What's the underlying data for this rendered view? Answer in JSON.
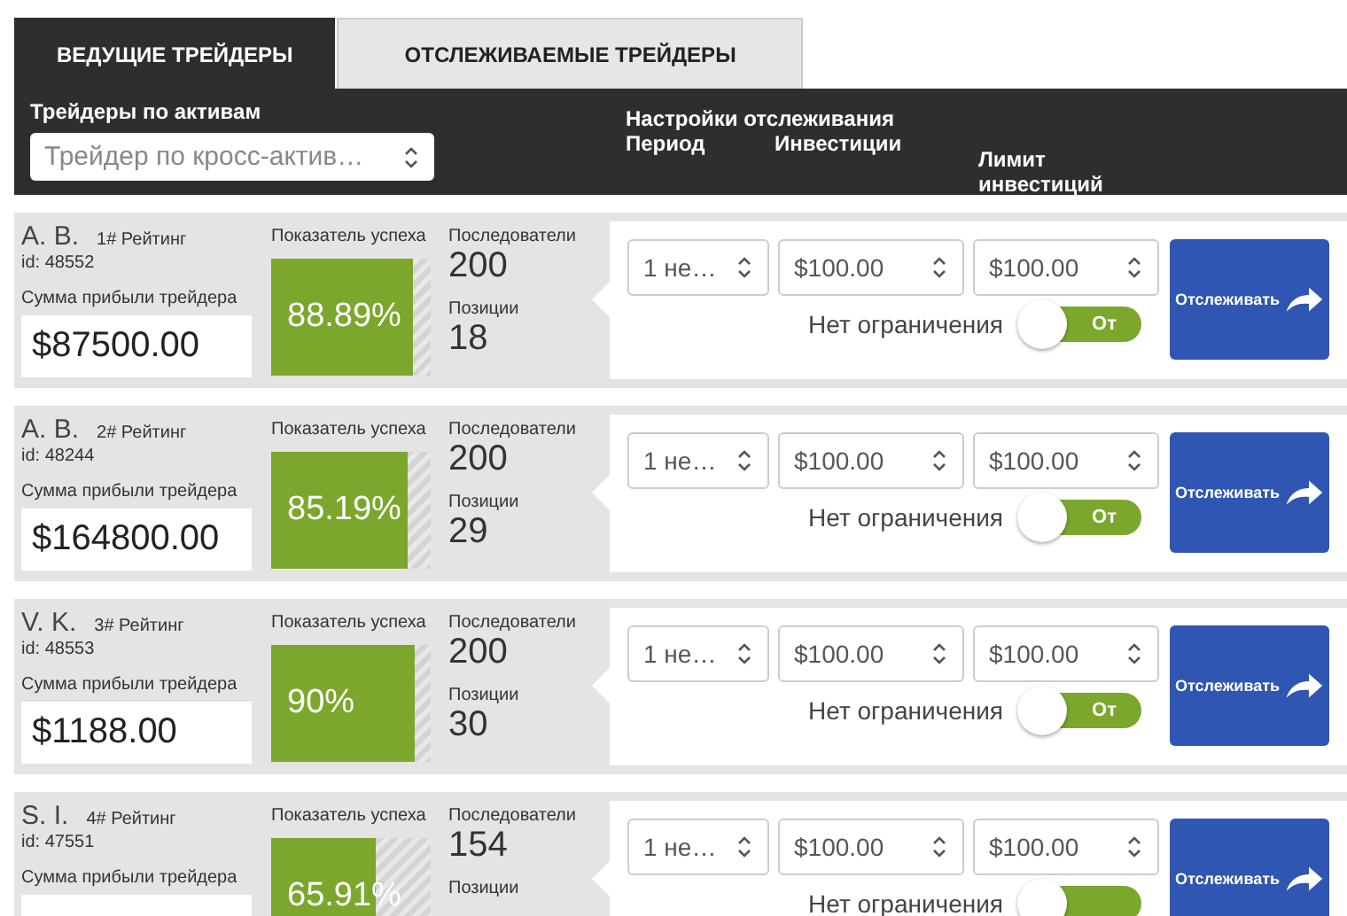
{
  "tabs": [
    {
      "label": "ВЕДУЩИЕ ТРЕЙДЕРЫ",
      "selected": true
    },
    {
      "label": "ОТСЛЕЖИВАЕМЫЕ ТРЕЙДЕРЫ",
      "selected": false
    }
  ],
  "filter": {
    "label": "Трейдеры по активам",
    "value": "Трейдер по кросс-актив…"
  },
  "settings": {
    "title": "Настройки отслеживания",
    "columns": [
      "Период",
      "Инвестиции",
      "Лимит инвестиций"
    ]
  },
  "traders": [
    {
      "name": "A. B.",
      "rating": "1# Рейтинг",
      "id": "id: 48552",
      "profit_label": "Сумма прибыли трейдера",
      "profit": "$87500.00",
      "success_label": "Показатель успеха",
      "level": 0.8889,
      "success": "88.89%",
      "followers_label": "Последователи",
      "followers": "200",
      "positions_label": "Позиции",
      "positions": "18",
      "period": "1 не…",
      "investment": "$100.00",
      "limit": "$100.00",
      "no_limit": "Нет ограничения",
      "toggle": {
        "label": "От",
        "on": true
      },
      "button": "Отслеживать"
    },
    {
      "name": "A. B.",
      "rating": "2# Рейтинг",
      "id": "id: 48244",
      "profit_label": "Сумма прибыли трейдера",
      "profit": "$164800.00",
      "success_label": "Показатель успеха",
      "level": 0.8519,
      "success": "85.19%",
      "followers_label": "Последователи",
      "followers": "200",
      "positions_label": "Позиции",
      "positions": "29",
      "period": "1 не…",
      "investment": "$100.00",
      "limit": "$100.00",
      "no_limit": "Нет ограничения",
      "toggle": {
        "label": "От",
        "on": true
      },
      "button": "Отслеживать"
    },
    {
      "name": "V. K.",
      "rating": "3# Рейтинг",
      "id": "id: 48553",
      "profit_label": "Сумма прибыли трейдера",
      "profit": "$1188.00",
      "success_label": "Показатель успеха",
      "level": 0.9,
      "success": "90%",
      "followers_label": "Последователи",
      "followers": "200",
      "positions_label": "Позиции",
      "positions": "30",
      "period": "1 не…",
      "investment": "$100.00",
      "limit": "$100.00",
      "no_limit": "Нет ограничения",
      "toggle": {
        "label": "От",
        "on": true
      },
      "button": "Отслеживать"
    },
    {
      "name": "S. I.",
      "rating": "4# Рейтинг",
      "id": "id: 47551",
      "profit_label": "Сумма прибыли трейдера",
      "success_label": "Показатель успеха",
      "level": 0.6591,
      "success": "65.91%",
      "followers_label": "Последователи",
      "followers": "154",
      "positions_label": "Позиции",
      "period": "1 не…",
      "investment": "$100.00",
      "limit": "$100.00",
      "no_limit": "Нет ограничения",
      "toggle": {
        "on": true
      },
      "button": "Отслеживать"
    }
  ]
}
